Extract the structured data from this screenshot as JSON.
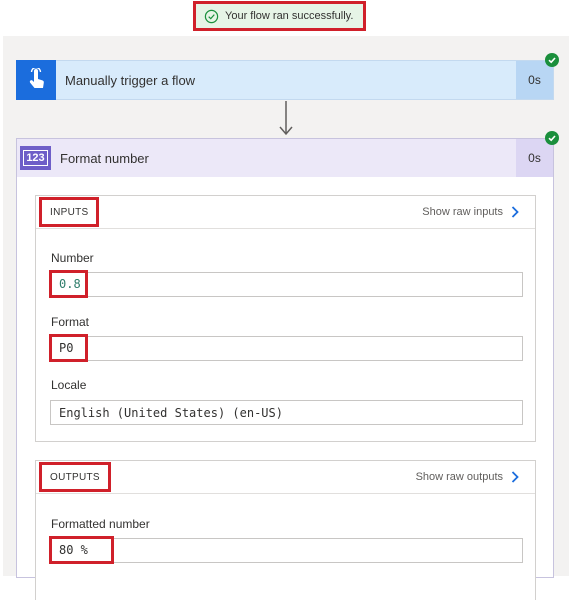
{
  "toast": {
    "message": "Your flow ran successfully.",
    "status_color": "#1a8f3c"
  },
  "trigger_step": {
    "title": "Manually trigger a flow",
    "duration": "0s",
    "icon": "hand-touch-icon"
  },
  "action_step": {
    "title": "Format number",
    "duration": "0s",
    "icon_text": "123",
    "inputs": {
      "label": "INPUTS",
      "raw_link": "Show raw inputs",
      "fields": {
        "number": {
          "label": "Number",
          "value": "0.8"
        },
        "format": {
          "label": "Format",
          "value": "P0"
        },
        "locale": {
          "label": "Locale",
          "value": "English (United States) (en-US)"
        }
      }
    },
    "outputs": {
      "label": "OUTPUTS",
      "raw_link": "Show raw outputs",
      "fields": {
        "formatted_number": {
          "label": "Formatted number",
          "value": "80 %"
        }
      }
    }
  },
  "colors": {
    "accent": "#1b6ddd",
    "action": "#6e5ec8",
    "highlight": "#d0202a"
  }
}
